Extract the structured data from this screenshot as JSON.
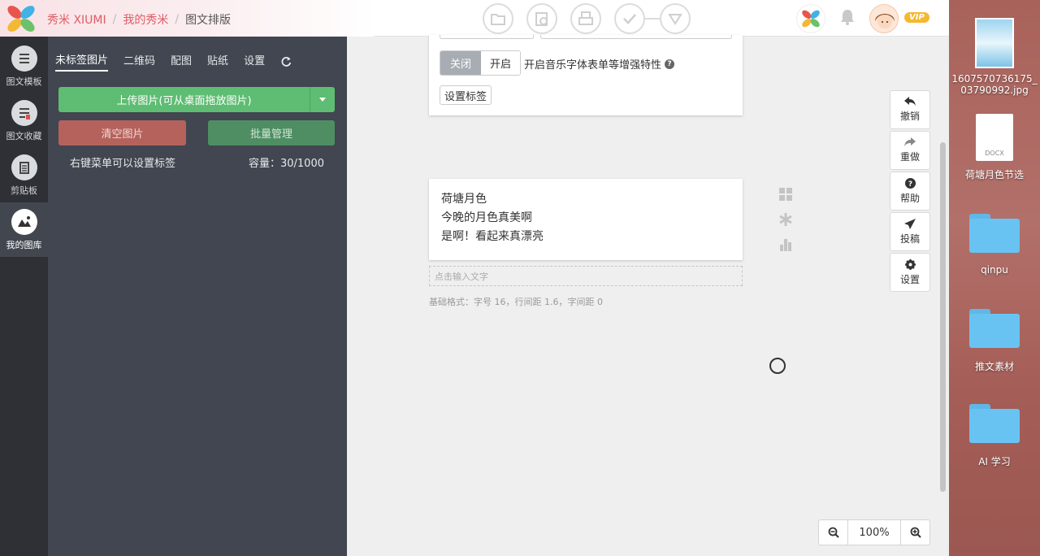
{
  "header": {
    "brand": "秀米 XIUMI",
    "crumb_mine": "我的秀米",
    "crumb_current": "图文排版",
    "separator": "/",
    "vip_badge": "VIP",
    "toolbar_icons": [
      "folder-icon",
      "camera-icon",
      "print-icon",
      "check-icon",
      "triangle-down-icon"
    ],
    "colors": {
      "brand": "#e05b63"
    }
  },
  "rail": {
    "items": [
      {
        "label": "图文模板",
        "icon": "list-icon"
      },
      {
        "label": "图文收藏",
        "icon": "bookmark-list-icon"
      },
      {
        "label": "剪贴板",
        "icon": "clipboard-icon"
      },
      {
        "label": "我的图库",
        "icon": "gallery-icon"
      }
    ]
  },
  "panel": {
    "tabs": [
      {
        "label": "未标签图片"
      },
      {
        "label": "二维码"
      },
      {
        "label": "配图"
      },
      {
        "label": "贴纸"
      },
      {
        "label": "设置"
      }
    ],
    "upload_label": "上传图片(可从桌面拖放图片)",
    "clear_label": "清空图片",
    "batch_label": "批量管理",
    "hint": "右键菜单可以设置标签",
    "capacity": "容量：30/1000"
  },
  "canvas": {
    "toggle_off": "关闭",
    "toggle_on": "开启",
    "feature_text": "开启音乐字体表单等增强特性",
    "set_tag": "设置标签",
    "content_lines": [
      "荷塘月色",
      "今晚的月色真美啊",
      "是啊！看起来真漂亮"
    ],
    "input_placeholder": "点击输入文字",
    "base_format": "基础格式：字号 16，行间距 1.6，字间距 0",
    "zoom_value": "100%"
  },
  "actions": [
    {
      "label": "撤销",
      "icon": "undo-icon"
    },
    {
      "label": "重做",
      "icon": "redo-icon"
    },
    {
      "label": "帮助",
      "icon": "help-icon"
    },
    {
      "label": "投稿",
      "icon": "send-icon"
    },
    {
      "label": "设置",
      "icon": "gear-icon"
    }
  ],
  "desktop": {
    "items": [
      {
        "label": "1607570736175_03790992.jpg",
        "line1": "1607570736175_",
        "line2": "03790992.jpg"
      },
      {
        "label": "荷塘月色节选",
        "badge": "DOCX"
      },
      {
        "label": "qinpu"
      },
      {
        "label": "推文素材"
      },
      {
        "label": "AI 学习"
      }
    ]
  }
}
